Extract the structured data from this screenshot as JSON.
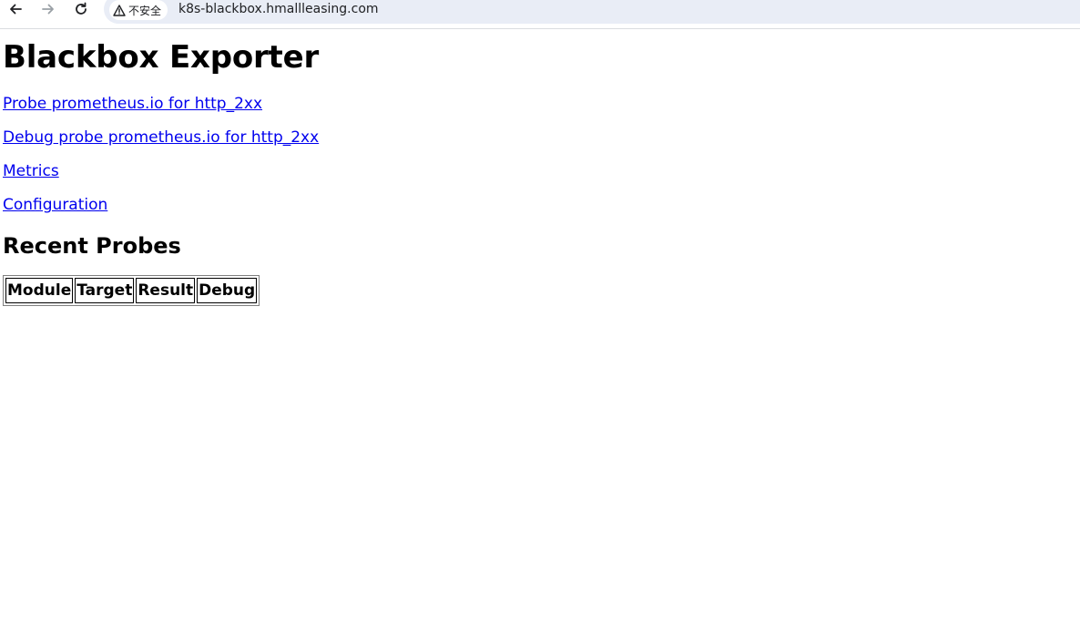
{
  "browser": {
    "security_label": "不安全",
    "url": "k8s-blackbox.hmallleasing.com",
    "icons": [
      "back-arrow-icon",
      "forward-arrow-icon",
      "reload-icon",
      "warning-icon"
    ]
  },
  "page": {
    "title": "Blackbox Exporter",
    "links": [
      "Probe prometheus.io for http_2xx",
      "Debug probe prometheus.io for http_2xx",
      "Metrics",
      "Configuration"
    ],
    "recent_heading": "Recent Probes",
    "table_headers": [
      "Module",
      "Target",
      "Result",
      "Debug"
    ]
  },
  "colors": {
    "link": "#0000ee",
    "omnibox": "#e9edf6"
  }
}
